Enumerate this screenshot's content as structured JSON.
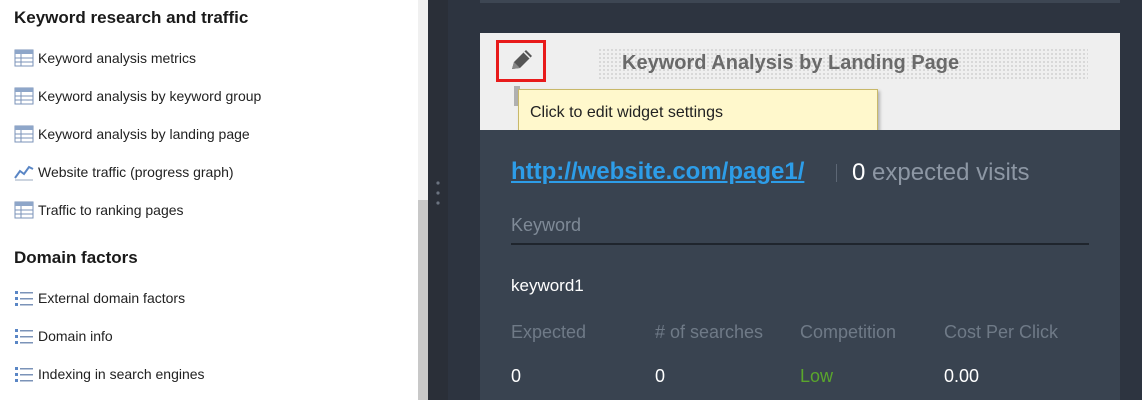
{
  "sidebar": {
    "sections": [
      {
        "title": "Keyword research and traffic",
        "items": [
          {
            "label": "Keyword analysis metrics",
            "icon": "table-icon"
          },
          {
            "label": "Keyword analysis by keyword group",
            "icon": "table-icon"
          },
          {
            "label": "Keyword analysis by landing page",
            "icon": "table-icon"
          },
          {
            "label": "Website traffic (progress graph)",
            "icon": "line-chart-icon"
          },
          {
            "label": "Traffic to ranking pages",
            "icon": "table-icon"
          }
        ]
      },
      {
        "title": "Domain factors",
        "items": [
          {
            "label": "External domain factors",
            "icon": "list-icon"
          },
          {
            "label": "Domain info",
            "icon": "list-icon"
          },
          {
            "label": "Indexing in search engines",
            "icon": "list-icon"
          }
        ]
      }
    ]
  },
  "widget": {
    "title": "Keyword Analysis by Landing Page",
    "edit_icon": "pencil-icon",
    "tooltip": "Click to edit widget settings",
    "url": "http://website.com/page1/",
    "visits_count": "0",
    "visits_label": "expected visits",
    "keyword_header": "Keyword",
    "keyword": "keyword1",
    "metrics": {
      "headers": [
        "Expected",
        "# of searches",
        "Competition",
        "Cost Per Click"
      ],
      "values": [
        "0",
        "0",
        "Low",
        "0.00"
      ]
    }
  },
  "colors": {
    "link": "#2d9de8",
    "competition_low": "#5aa62c",
    "edit_highlight": "#e81b1b",
    "panel_dark": "#394350"
  }
}
